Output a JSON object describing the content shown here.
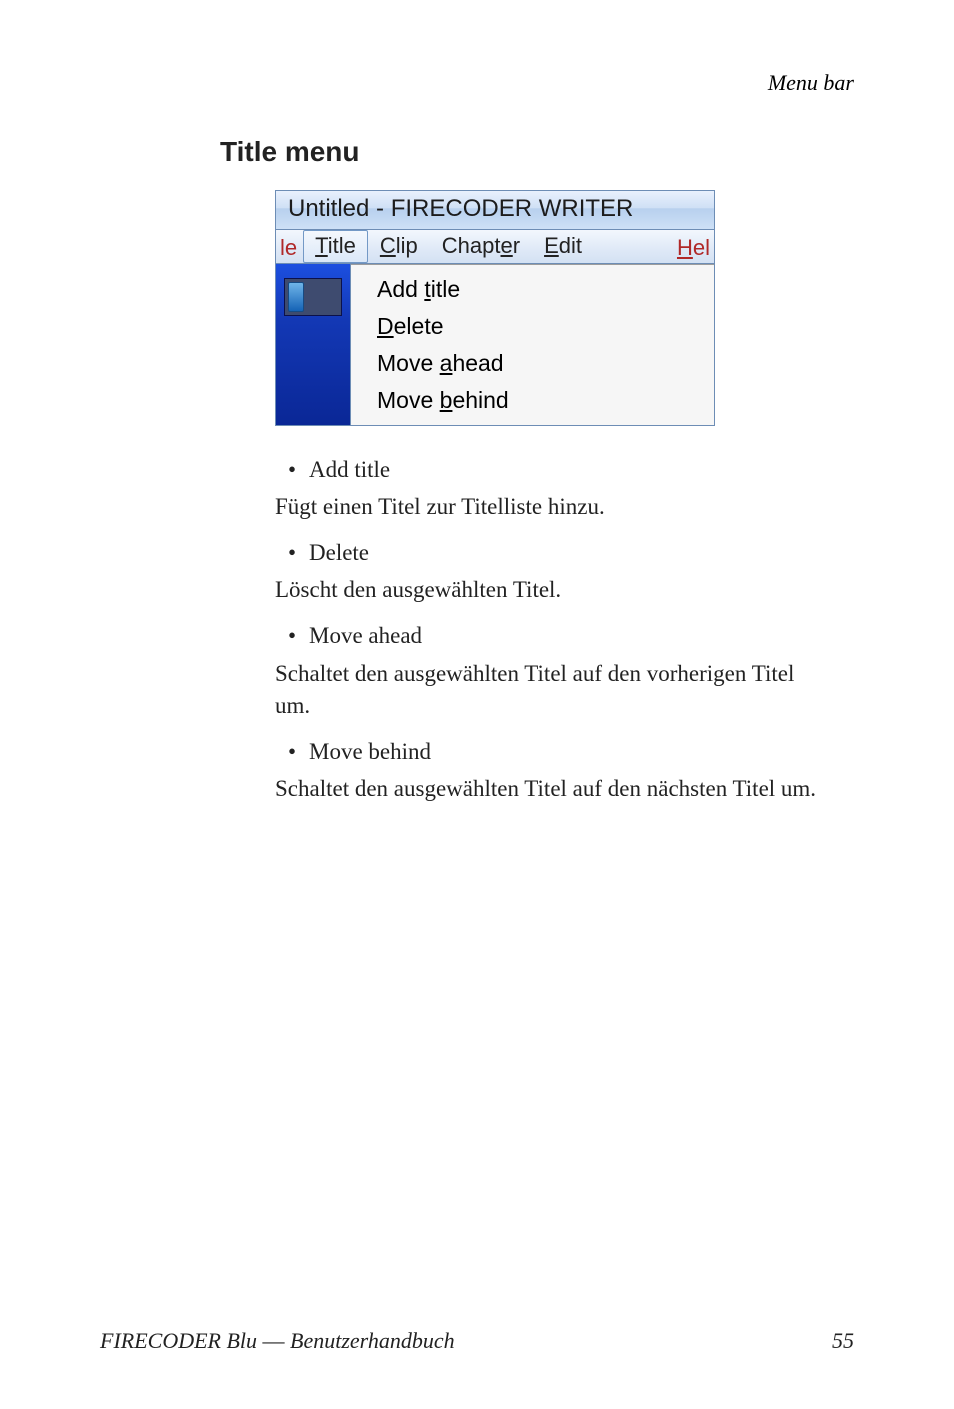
{
  "header": {
    "running_head": "Menu bar"
  },
  "section": {
    "heading": "Title menu"
  },
  "screenshot": {
    "window_title": "Untitled - FIRECODER WRITER",
    "left_cut": "le",
    "right_cut": "Hel",
    "menubar": {
      "title": "Title",
      "clip": "Clip",
      "chapter": "Chapter",
      "edit": "Edit"
    },
    "dropdown": {
      "add_title": "Add title",
      "delete": "Delete",
      "move_ahead": "Move ahead",
      "move_behind": "Move behind"
    }
  },
  "body": {
    "bullets": {
      "add_title": "Add title",
      "delete": "Delete",
      "move_ahead": "Move ahead",
      "move_behind": "Move behind"
    },
    "paras": {
      "p1": "Fügt einen Titel zur Titelliste hinzu.",
      "p2": "Löscht den ausgewählten Titel.",
      "p3": "Schaltet den ausgewählten Titel auf den vorherigen Titel um.",
      "p4": "Schaltet den ausgewählten Titel auf den nächsten Titel um."
    }
  },
  "footer": {
    "left": "FIRECODER Blu  ―  Benutzerhandbuch",
    "page": "55"
  }
}
